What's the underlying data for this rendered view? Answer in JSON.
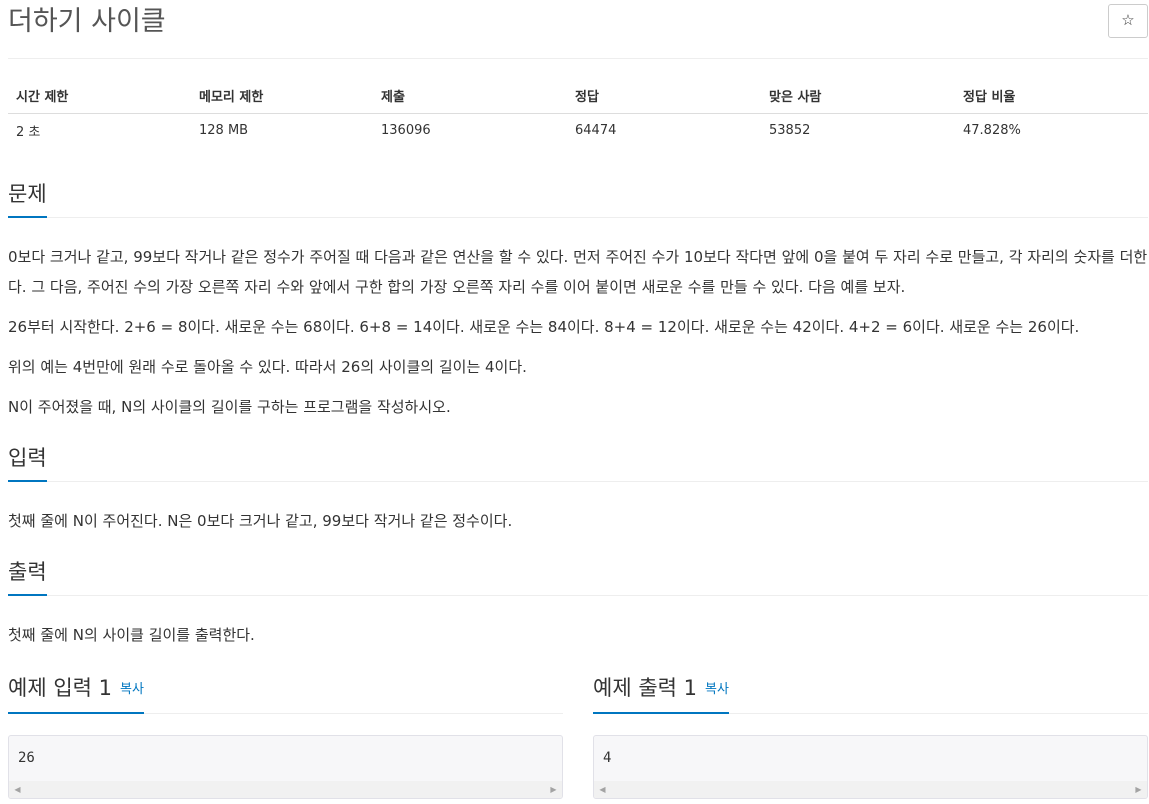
{
  "problem": {
    "title": "더하기 사이클",
    "star_icon": "☆"
  },
  "info_table": {
    "headers": [
      "시간 제한",
      "메모리 제한",
      "제출",
      "정답",
      "맞은 사람",
      "정답 비율"
    ],
    "values": [
      "2 초",
      "128 MB",
      "136096",
      "64474",
      "53852",
      "47.828%"
    ]
  },
  "description": {
    "heading": "문제",
    "paragraphs": [
      "0보다 크거나 같고, 99보다 작거나 같은 정수가 주어질 때 다음과 같은 연산을 할 수 있다. 먼저 주어진 수가 10보다 작다면 앞에 0을 붙여 두 자리 수로 만들고, 각 자리의 숫자를 더한다. 그 다음, 주어진 수의 가장 오른쪽 자리 수와 앞에서 구한 합의 가장 오른쪽 자리 수를 이어 붙이면 새로운 수를 만들 수 있다. 다음 예를 보자.",
      "26부터 시작한다. 2+6 = 8이다. 새로운 수는 68이다. 6+8 = 14이다. 새로운 수는 84이다. 8+4 = 12이다. 새로운 수는 42이다. 4+2 = 6이다. 새로운 수는 26이다.",
      "위의 예는 4번만에 원래 수로 돌아올 수 있다. 따라서 26의 사이클의 길이는 4이다.",
      "N이 주어졌을 때, N의 사이클의 길이를 구하는 프로그램을 작성하시오."
    ]
  },
  "input_section": {
    "heading": "입력",
    "text": "첫째 줄에 N이 주어진다. N은 0보다 크거나 같고, 99보다 작거나 같은 정수이다."
  },
  "output_section": {
    "heading": "출력",
    "text": "첫째 줄에 N의 사이클 길이를 출력한다."
  },
  "sample_input": {
    "heading": "예제 입력 1",
    "copy_label": "복사",
    "content": "26"
  },
  "sample_output": {
    "heading": "예제 출력 1",
    "copy_label": "복사",
    "content": "4"
  },
  "scroll_arrows": {
    "left": "◀",
    "right": "▶"
  },
  "colors": {
    "accent": "#0076c0",
    "pre_background": "#f7f7f9"
  }
}
